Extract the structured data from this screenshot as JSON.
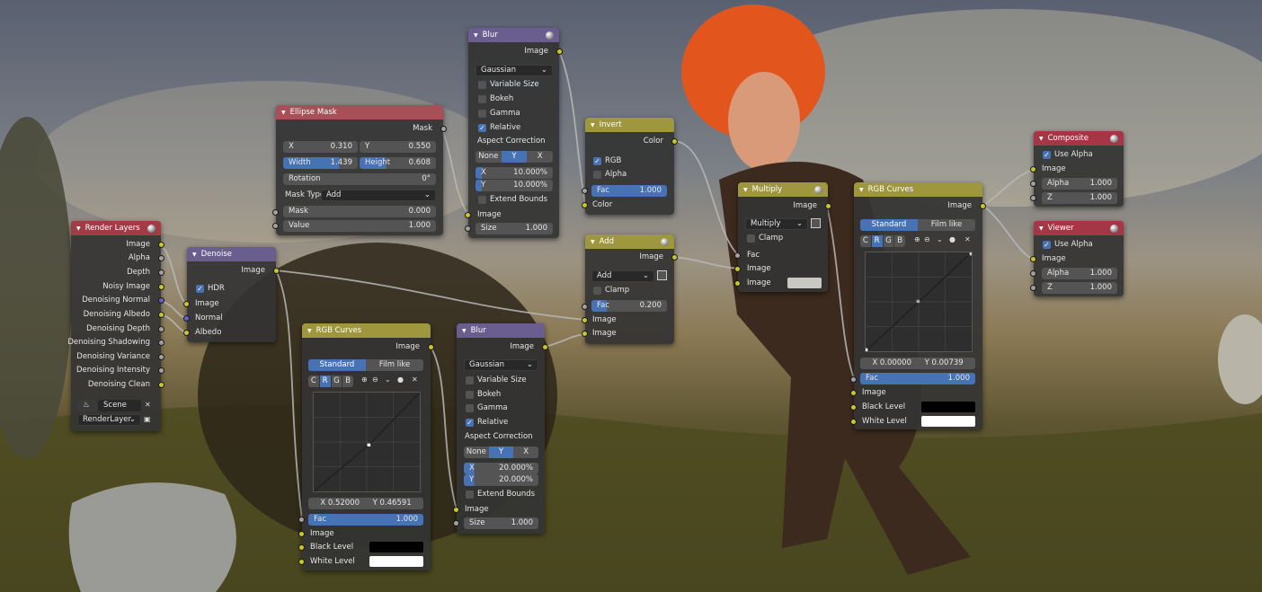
{
  "blur_top": {
    "title": "Blur",
    "output": "Image",
    "filter": "Gaussian",
    "opts": [
      "Variable Size",
      "Bokeh",
      "Gamma",
      "Relative"
    ],
    "aspect_label": "Aspect Correction",
    "aspect": [
      "None",
      "Y",
      "X"
    ],
    "x_label": "X",
    "x_value": "10.000%",
    "y_label": "Y",
    "y_value": "10.000%",
    "extend": "Extend Bounds",
    "input_image": "Image",
    "size_label": "Size",
    "size_value": "1.000"
  },
  "ellipse": {
    "title": "Ellipse Mask",
    "output": "Mask",
    "x_label": "X",
    "x_value": "0.310",
    "y_label": "Y",
    "y_value": "0.550",
    "width_label": "Width",
    "width_value": "1.439",
    "height_label": "Height",
    "height_value": "0.608",
    "rot_label": "Rotation",
    "rot_value": "0°",
    "mask_type_label": "Mask Type:",
    "mask_type": "Add",
    "in_mask": "Mask",
    "in_mask_value": "0.000",
    "in_value": "Value",
    "in_value_value": "1.000"
  },
  "invert": {
    "title": "Invert",
    "output": "Color",
    "rgb": "RGB",
    "alpha": "Alpha",
    "fac_label": "Fac",
    "fac_value": "1.000",
    "input": "Color"
  },
  "add": {
    "title": "Add",
    "output": "Image",
    "mode": "Add",
    "clamp": "Clamp",
    "fac_label": "Fac",
    "fac_value": "0.200",
    "in1": "Image",
    "in2": "Image"
  },
  "multiply": {
    "title": "Multiply",
    "output": "Image",
    "mode": "Multiply",
    "clamp": "Clamp",
    "fac": "Fac",
    "in1": "Image",
    "in2": "Image"
  },
  "curves_right": {
    "title": "RGB Curves",
    "output": "Image",
    "tabs": [
      "Standard",
      "Film like"
    ],
    "channels": [
      "C",
      "R",
      "G",
      "B"
    ],
    "x_readout": "X 0.00000",
    "y_readout": "Y 0.00739",
    "fac_label": "Fac",
    "fac_value": "1.000",
    "in_image": "Image",
    "black": "Black Level",
    "white": "White Level"
  },
  "composite": {
    "title": "Composite",
    "use_alpha": "Use Alpha",
    "image": "Image",
    "alpha_label": "Alpha",
    "alpha_value": "1.000",
    "z_label": "Z",
    "z_value": "1.000"
  },
  "viewer": {
    "title": "Viewer",
    "use_alpha": "Use Alpha",
    "image": "Image",
    "alpha_label": "Alpha",
    "alpha_value": "1.000",
    "z_label": "Z",
    "z_value": "1.000"
  },
  "render_layers": {
    "title": "Render Layers",
    "outputs": [
      "Image",
      "Alpha",
      "Depth",
      "Noisy Image",
      "Denoising Normal",
      "Denoising Albedo",
      "Denoising Depth",
      "Denoising Shadowing",
      "Denoising Variance",
      "Denoising Intensity",
      "Denoising Clean"
    ],
    "scene": "Scene",
    "layer": "RenderLayer"
  },
  "denoise": {
    "title": "Denoise",
    "output": "Image",
    "hdr": "HDR",
    "inputs": [
      "Image",
      "Normal",
      "Albedo"
    ]
  },
  "curves_left": {
    "title": "RGB Curves",
    "output": "Image",
    "tabs": [
      "Standard",
      "Film like"
    ],
    "channels": [
      "C",
      "R",
      "G",
      "B"
    ],
    "x_readout": "X 0.52000",
    "y_readout": "Y 0.46591",
    "fac_label": "Fac",
    "fac_value": "1.000",
    "in_image": "Image",
    "black": "Black Level",
    "white": "White Level"
  },
  "blur_bottom": {
    "title": "Blur",
    "output": "Image",
    "filter": "Gaussian",
    "opts": [
      "Variable Size",
      "Bokeh",
      "Gamma",
      "Relative"
    ],
    "aspect_label": "Aspect Correction",
    "aspect": [
      "None",
      "Y",
      "X"
    ],
    "x_label": "X",
    "x_value": "20.000%",
    "y_label": "Y",
    "y_value": "20.000%",
    "extend": "Extend Bounds",
    "input_image": "Image",
    "size_label": "Size",
    "size_value": "1.000"
  },
  "colors": {
    "image_socket": "#c7c729",
    "value_socket": "#a1a1a1",
    "vector_socket": "#6363c7",
    "accent": "#4772b3"
  }
}
